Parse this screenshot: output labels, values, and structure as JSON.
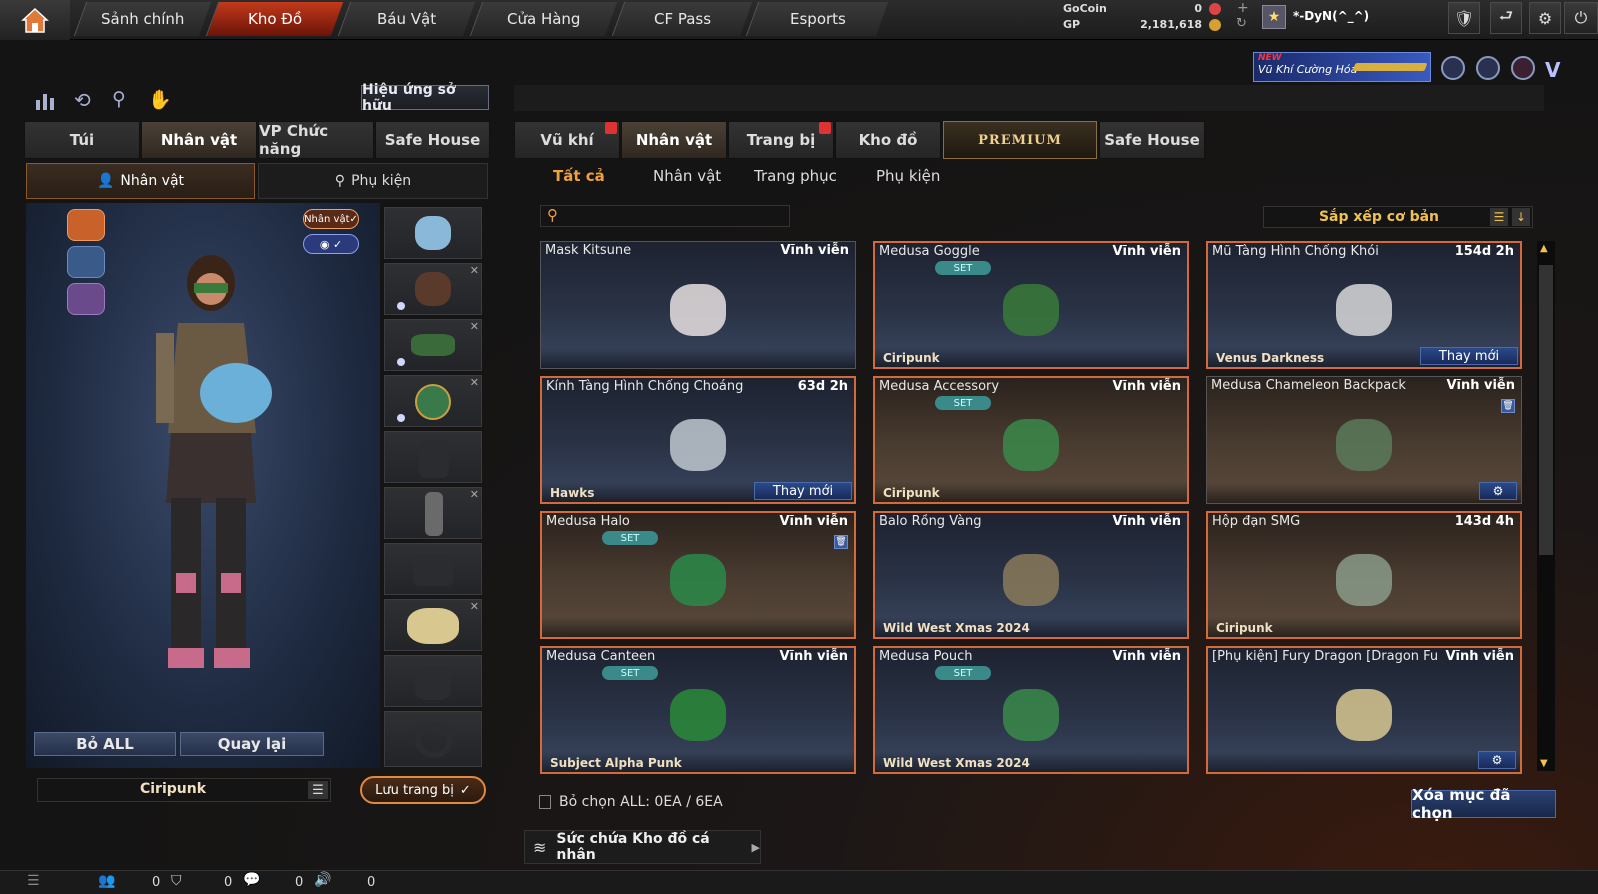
{
  "topbar": {
    "tabs": [
      "Sảnh chính",
      "Kho Đồ",
      "Báu Vật",
      "Cửa Hàng",
      "CF Pass",
      "Esports"
    ],
    "active_tab": "Kho Đồ",
    "gocoin_label": "GoCoin",
    "gocoin_value": "0",
    "gp_label": "GP",
    "gp_value": "2,181,618",
    "username": "*-DyN(^_^)",
    "banner_new": "NEW",
    "banner_text": "Vũ Khí Cường Hóa"
  },
  "left": {
    "owned_effects_label": "Hiệu ứng sở hữu",
    "tabs": [
      "Túi",
      "Nhân vật",
      "VP Chức năng",
      "Safe House"
    ],
    "active_tab": "Nhân vật",
    "subtabs": [
      "Nhân vật",
      "Phụ kiện"
    ],
    "active_subtab": "Nhân vật",
    "character_badge": "Nhân vật",
    "remove_all_label": "Bỏ ALL",
    "back_label": "Quay lại",
    "character_name": "Ciripunk",
    "save_label": "Lưu trang bị"
  },
  "right": {
    "tabs": [
      "Vũ khí",
      "Nhân vật",
      "Trang bị",
      "Kho đồ",
      "PREMIUM",
      "Safe House"
    ],
    "active_tab": "Nhân vật",
    "categories": [
      "Tất cả",
      "Nhân vật",
      "Trang phục",
      "Phụ kiện"
    ],
    "active_category": "Tất cả",
    "search_placeholder": "",
    "sort_label": "Sắp xếp cơ bản",
    "set_label": "SET",
    "renew_label": "Thay mới",
    "items": [
      {
        "name": "Mask Kitsune",
        "duration": "Vĩnh viễn",
        "sub": "",
        "set": false,
        "style": "blue"
      },
      {
        "name": "Medusa Goggle",
        "duration": "Vĩnh viễn",
        "sub": "Ciripunk",
        "set": true,
        "style": "blue"
      },
      {
        "name": "Mũ Tàng Hình Chống Khói",
        "duration": "154d 2h",
        "sub": "Venus Darkness",
        "set": false,
        "style": "blue",
        "renew": true
      },
      {
        "name": "Kính Tàng Hình Chống Choáng",
        "duration": "63d 2h",
        "sub": "Hawks",
        "set": false,
        "style": "blue",
        "renew": true
      },
      {
        "name": "Medusa Accessory",
        "duration": "Vĩnh viễn",
        "sub": "Ciripunk",
        "set": true,
        "style": "brown"
      },
      {
        "name": "Medusa Chameleon Backpack",
        "duration": "Vĩnh viễn",
        "sub": "",
        "set": false,
        "style": "brown"
      },
      {
        "name": "Medusa Halo",
        "duration": "Vĩnh viễn",
        "sub": "",
        "set": true,
        "style": "brown"
      },
      {
        "name": "Balo Rồng Vàng",
        "duration": "Vĩnh viễn",
        "sub": "Wild West Xmas 2024",
        "set": false,
        "style": "blue"
      },
      {
        "name": "Hộp đạn SMG",
        "duration": "143d 4h",
        "sub": "Ciripunk",
        "set": false,
        "style": "brown"
      },
      {
        "name": "Medusa Canteen",
        "duration": "Vĩnh viễn",
        "sub": "Subject Alpha Punk",
        "set": true,
        "style": "blue"
      },
      {
        "name": "Medusa Pouch",
        "duration": "Vĩnh viễn",
        "sub": "Wild West Xmas 2024",
        "set": true,
        "style": "blue"
      },
      {
        "name": "[Phụ kiện] Fury Dragon [Dragon Fu",
        "duration": "Vĩnh viễn",
        "sub": "",
        "set": false,
        "style": "blue"
      }
    ],
    "deselect_label": "Bỏ chọn ALL: 0EA / 6EA",
    "delete_selected_label": "Xóa mục đã chọn",
    "capacity_label": "Sức chứa Kho đồ cá nhân"
  },
  "bottombar": {
    "counts": [
      "0",
      "0",
      "0",
      "0"
    ]
  }
}
